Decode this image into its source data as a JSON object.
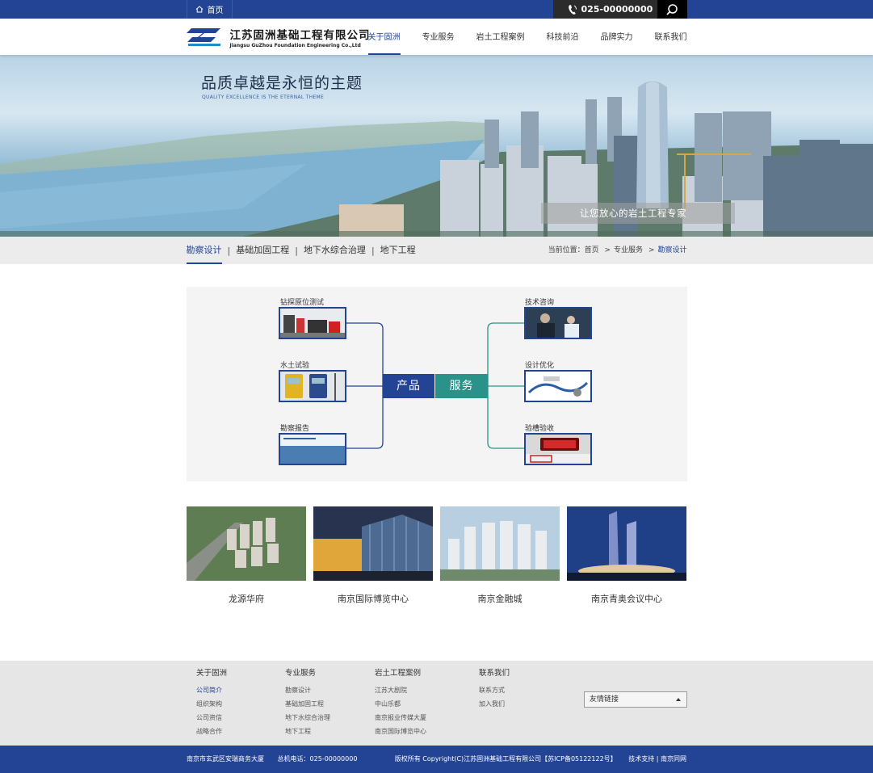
{
  "topbar": {
    "home_label": "首页",
    "phone": "025-00000000"
  },
  "header": {
    "company_name_cn": "江苏固洲基础工程有限公司",
    "company_name_en": "Jiangsu GuZhou Foundation Engineering Co.,Ltd",
    "nav": [
      {
        "label": "关于固洲",
        "active": true
      },
      {
        "label": "专业服务",
        "active": false
      },
      {
        "label": "岩土工程案例",
        "active": false
      },
      {
        "label": "科技前沿",
        "active": false
      },
      {
        "label": "品牌实力",
        "active": false
      },
      {
        "label": "联系我们",
        "active": false
      }
    ]
  },
  "banner": {
    "title": "品质卓越是永恒的主题",
    "subtitle": "QUALITY EXCELLENCE IS THE ETERNAL THEME",
    "tagline": "让您放心的岩土工程专家"
  },
  "subnav": {
    "tabs": [
      "勘察设计",
      "基础加固工程",
      "地下水综合治理",
      "地下工程"
    ],
    "separator": "|",
    "breadcrumb_prefix": "当前位置：",
    "breadcrumb": [
      "首页",
      "专业服务",
      "勘察设计"
    ],
    "breadcrumb_sep": ">"
  },
  "diagram": {
    "center_left": "产品",
    "center_right": "服务",
    "left_items": [
      "钻探原位测试",
      "水土试验",
      "勘察报告"
    ],
    "right_items": [
      "技术咨询",
      "设计优化",
      "验槽验收"
    ]
  },
  "projects": [
    "龙源华府",
    "南京国际博览中心",
    "南京金融城",
    "南京青奥会议中心"
  ],
  "footer": {
    "columns": [
      {
        "title": "关于固洲",
        "links": [
          "公司简介",
          "组织架构",
          "公司资信",
          "战略合作"
        ],
        "active_index": 0
      },
      {
        "title": "专业服务",
        "links": [
          "勘察设计",
          "基础加固工程",
          "地下水综合治理",
          "地下工程"
        ],
        "active_index": -1
      },
      {
        "title": "岩土工程案例",
        "links": [
          "江苏大剧院",
          "中山乐都",
          "南京报业传媒大厦",
          "南京国际博览中心"
        ],
        "active_index": -1
      },
      {
        "title": "联系我们",
        "links": [
          "联系方式",
          "加入我们"
        ],
        "active_index": -1
      }
    ],
    "friend_links_label": "友情链接",
    "address": "南京市玄武区安瑞商务大厦",
    "hotline": "总机电话：025-00000000",
    "copyright": "版权所有 Copyright(C)江苏固洲基础工程有限公司【苏ICP备05122122号】",
    "support": "技术支持 | 南京同网"
  },
  "colors": {
    "primary": "#234394",
    "accent": "#2a9289",
    "topbar_dark": "#2b2b2b"
  },
  "icons": {
    "home": "home-icon",
    "phone": "phone-icon",
    "search": "search-icon",
    "logo": "logo-mark-icon"
  }
}
